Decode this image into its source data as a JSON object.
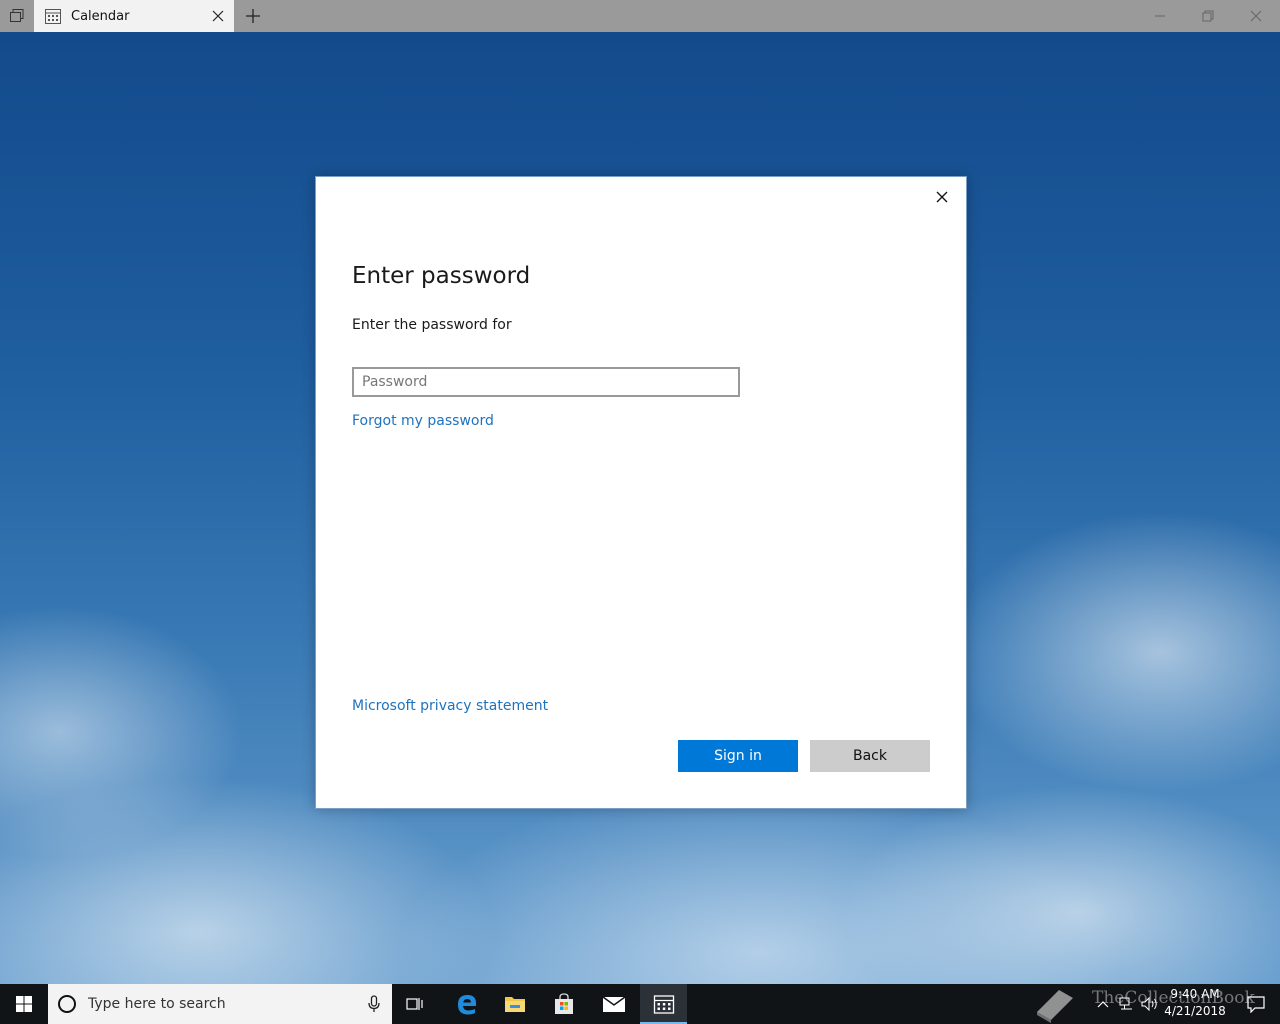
{
  "window": {
    "tab_title": "Calendar"
  },
  "dialog": {
    "heading": "Enter password",
    "subtitle": "Enter the password for",
    "password_placeholder": "Password",
    "password_value": "",
    "forgot_link": "Forgot my password",
    "privacy_link": "Microsoft privacy statement",
    "sign_in_label": "Sign in",
    "back_label": "Back"
  },
  "taskbar": {
    "search_placeholder": "Type here to search",
    "pinned": [
      "task-view",
      "edge",
      "file-explorer",
      "store",
      "mail",
      "calendar"
    ],
    "clock_time": "9:40 AM",
    "clock_date": "4/21/2018",
    "watermark": "TheCollectionBook"
  },
  "colors": {
    "accent": "#0078d7",
    "link": "#1e73be",
    "taskbar": "#101417"
  }
}
